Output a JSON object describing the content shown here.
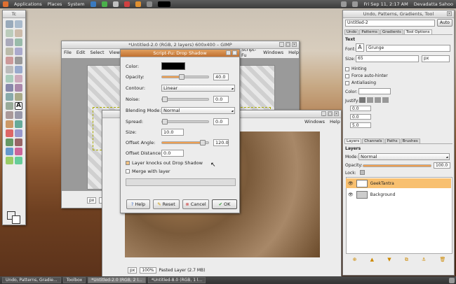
{
  "topbar": {
    "menus": [
      "Applications",
      "Places",
      "System"
    ],
    "datetime": "Fri Sep 11,  2:17 AM",
    "user": "Devadatta Sahoo"
  },
  "toolbox": {
    "title": "Tc"
  },
  "gimp_window": {
    "title": "*Untitled-2.0 (RGB, 2 layers) 600x400 – GIMP",
    "menus": [
      "File",
      "Edit",
      "Select",
      "View",
      "Script-Fu",
      "Windows",
      "Help"
    ],
    "unit": "px",
    "zoom": "100"
  },
  "gimp_window2": {
    "menus": [
      "Windows",
      "Help"
    ],
    "unit": "px",
    "zoom": "100%",
    "status": "Pasted Layer (2.7 MB)"
  },
  "dialog": {
    "title": "Script-Fu: Drop Shadow",
    "color_label": "Color:",
    "color_value": "#000000",
    "opacity_label": "Opacity:",
    "opacity_value": "40.0",
    "contour_label": "Contour:",
    "contour_value": "Linear",
    "noise_label": "Noise:",
    "noise_value": "0.0",
    "blend_label": "Blending Mode:",
    "blend_value": "Normal",
    "spread_label": "Spread:",
    "spread_value": "0.0",
    "size_label": "Size:",
    "size_value": "10.0",
    "angle_label": "Offset Angle:",
    "angle_value": "120.0",
    "distance_label": "Offset Distance:",
    "distance_value": "0.0",
    "knockout_label": "Layer knocks out Drop Shadow",
    "merge_label": "Merge with layer",
    "help": "Help",
    "reset": "Reset",
    "cancel": "Cancel",
    "ok": "OK"
  },
  "dock": {
    "title": "Undo, Patterns, Gradients, Tool",
    "image_select": "Untitled-2",
    "auto": "Auto",
    "tabs": [
      "Undo",
      "Patterns",
      "Gradients",
      "Tool Options"
    ],
    "text_header": "Text",
    "font_label": "Font:",
    "font_value": "Grunge",
    "size_label": "Size:",
    "size_value": "65",
    "size_unit": "px",
    "hinting": "Hinting",
    "force_autohinter": "Force auto-hinter",
    "antialiasing": "Antialiasing",
    "color_label": "Color:",
    "justify_label": "Justify:",
    "indent_vals": [
      "0.0",
      "0.0",
      "5.0"
    ],
    "layers_tabs": [
      "Layers",
      "Channels",
      "Paths",
      "Brushes"
    ],
    "layers_header": "Layers",
    "mode_label": "Mode:",
    "mode_value": "Normal",
    "opacity_label": "Opacity:",
    "opacity_value": "100.0",
    "lock_label": "Lock:",
    "layers": [
      {
        "name": "GeekTantra",
        "selected": true
      },
      {
        "name": "Background",
        "selected": false
      }
    ]
  },
  "taskbar": [
    "Undo, Patterns, Gradie...",
    "Toolbox",
    "*Untitled-2.0 (RGB, 2 l...",
    "*Untitled-8.0 (RGB, 1 l..."
  ],
  "colors": {
    "accent": "#f0a050",
    "selected_layer": "#f8c070"
  }
}
